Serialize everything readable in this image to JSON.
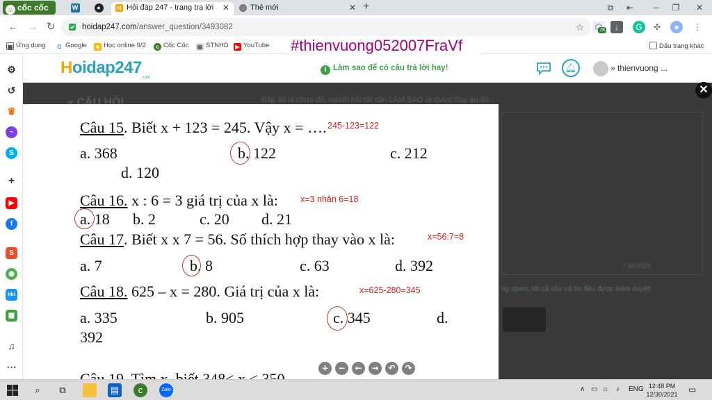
{
  "browser": {
    "brand": "cốc cốc",
    "tabs": [
      {
        "title": "Hỏi đáp 247 - trang tra lời",
        "active": true
      },
      {
        "title": "Thẻ mới",
        "active": false
      }
    ],
    "url_host": "hoidap247.com",
    "url_path": "/answer_question/3493082",
    "ext_badge": "78",
    "bookmarks": [
      "Ứng dụng",
      "Google",
      "Học online 9/2",
      "Cốc Cốc",
      "STNHD",
      "YouTube"
    ],
    "other_bookmarks": "Dấu trang khác"
  },
  "overlay_hashtag": "#thienvuong052007FraVf",
  "site": {
    "logo_main": "oidap247",
    "logo_first": "H",
    "logo_sub": ".com",
    "howto": "Làm sao để có câu trả lời hay!",
    "username": "thienvuong ..."
  },
  "behind": {
    "heading": "« CÂU HỎI",
    "hint": "Đáp án là chưa đủ, người hỏi rất cần LÀM SAO ra được đáp án đó.",
    "word_count": "7 WORDS",
    "moderation": "ng spam, tất cả câu trả lời đều được kiểm duyệt!"
  },
  "worksheet": {
    "q15": {
      "num": "Câu 15",
      "text": ". Biết x + 123 = 245. Vậy x = ….",
      "note": "245-123=122",
      "opts": [
        "a. 368",
        "b. 122",
        "c. 212",
        "d. 120"
      ],
      "circled": "b"
    },
    "q16": {
      "num": "Câu 16.",
      "text": " x : 6 = 3 giá trị của x là:",
      "note": "x=3 nhân 6=18",
      "opts": [
        "a. 18",
        "b. 2",
        "c. 20",
        "d. 21"
      ],
      "circled": "a"
    },
    "q17": {
      "num": "Câu 17",
      "text": ". Biết x x 7 = 56. Số thích hợp thay vào x là:",
      "note": "x=56:7=8",
      "opts": [
        "a. 7",
        "b. 8",
        "c. 63",
        "d. 392"
      ],
      "circled": "b"
    },
    "q18": {
      "num": "Câu 18.",
      "text": "  625 – x  = 280. Giá trị của  x là:",
      "note": "x=625-280=345",
      "opts": [
        "a. 335",
        "b. 905",
        "c. 345",
        "d.",
        "392"
      ],
      "circled": "c"
    },
    "q19_partial": "Câu 19. Tìm x, biết 348< x < 350"
  },
  "viewer_controls": [
    "+",
    "−",
    "←",
    "→",
    "↶",
    "↷"
  ],
  "taskbar": {
    "lang": "ENG",
    "time": "12:48 PM",
    "date": "12/30/2021"
  }
}
